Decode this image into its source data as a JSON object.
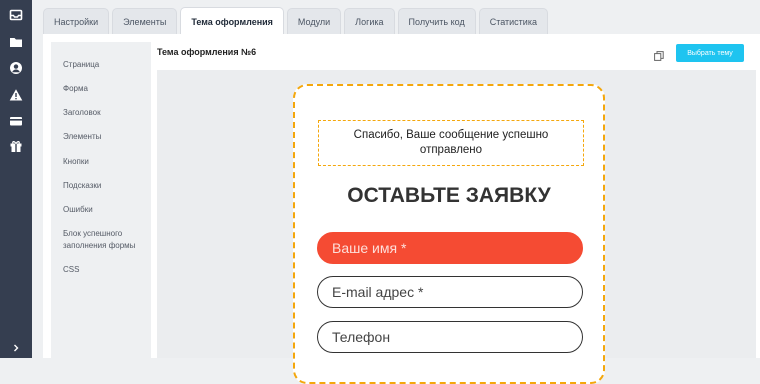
{
  "tabs": [
    {
      "label": "Настройки"
    },
    {
      "label": "Элементы"
    },
    {
      "label": "Тема оформления",
      "active": true
    },
    {
      "label": "Модули"
    },
    {
      "label": "Логика"
    },
    {
      "label": "Получить код"
    },
    {
      "label": "Статистика"
    }
  ],
  "side_menu": [
    {
      "label": "Страница"
    },
    {
      "label": "Форма"
    },
    {
      "label": "Заголовок"
    },
    {
      "label": "Элементы"
    },
    {
      "label": "Кнопки"
    },
    {
      "label": "Подсказки"
    },
    {
      "label": "Ошибки"
    },
    {
      "label": "Блок успешного заполнения формы"
    },
    {
      "label": "CSS"
    }
  ],
  "header": {
    "theme_title": "Тема оформления №6",
    "choose_button": "Выбрать тему"
  },
  "preview": {
    "success_message": "Спасибо, Ваше сообщение успешно отправлено",
    "heading": "ОСТАВЬТЕ ЗАЯВКУ",
    "fields": [
      {
        "placeholder": "Ваше имя *",
        "state": "error"
      },
      {
        "placeholder": "E-mail адрес *",
        "state": "normal"
      },
      {
        "placeholder": "Телефон",
        "state": "normal"
      }
    ]
  },
  "colors": {
    "rail": "#353e50",
    "accent_button": "#1ec4f0",
    "dashed_border": "#f4a70c",
    "error_field": "#f54b33"
  },
  "icons": {
    "rail": [
      "inbox-icon",
      "folder-icon",
      "user-circle-icon",
      "warning-icon",
      "card-icon",
      "gift-icon",
      "chevron-right-icon"
    ],
    "header": [
      "copy-icon"
    ]
  }
}
